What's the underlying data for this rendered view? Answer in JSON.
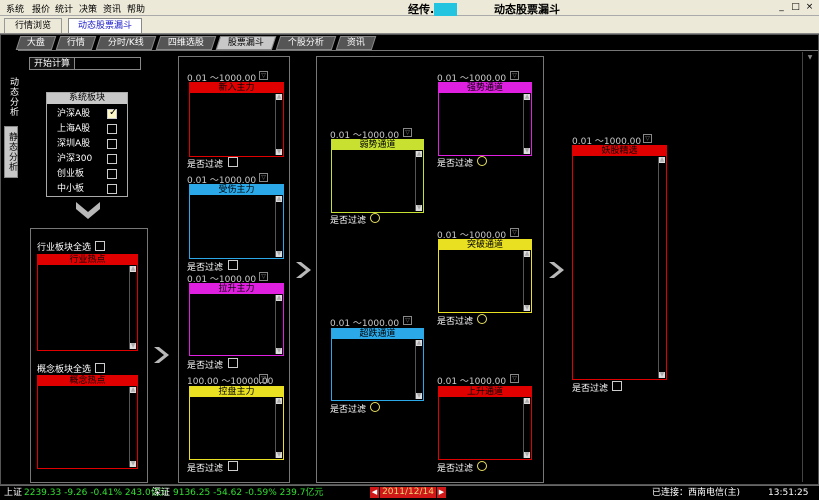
{
  "menubar": {
    "items": [
      "系统",
      "报价",
      "统计",
      "决策",
      "资讯",
      "帮助"
    ],
    "title_masked": "经传.",
    "title_mask_text": "····",
    "subtitle": "动态股票漏斗",
    "win_buttons": [
      "_",
      "□",
      "×"
    ]
  },
  "top_tabs": [
    {
      "label": "行情浏览"
    },
    {
      "label": "动态股票漏斗"
    }
  ],
  "nav_tabs": [
    "大盘",
    "行情",
    "分时/K线",
    "四维选股",
    "股票漏斗",
    "个股分析",
    "资讯"
  ],
  "side_tabs": [
    "动态分析",
    "静态分析"
  ],
  "start_button": "开始计算",
  "system_sector": {
    "title": "系统板块",
    "items": [
      {
        "label": "沪深A股",
        "checked": true
      },
      {
        "label": "上海A股",
        "checked": false
      },
      {
        "label": "深圳A股",
        "checked": false
      },
      {
        "label": "沪深300",
        "checked": false
      },
      {
        "label": "创业板",
        "checked": false
      },
      {
        "label": "中小板",
        "checked": false
      }
    ]
  },
  "sector_group": {
    "industry_select_all": "行业板块全选",
    "industry_panel": "行业热点",
    "concept_select_all": "概念板块全选",
    "concept_panel": "概念热点"
  },
  "filter_label": "是否过滤",
  "col1": [
    {
      "range": "0.01 ～1000.00",
      "title": "新入主力",
      "color": "#e00000"
    },
    {
      "range": "0.01 ～1000.00",
      "title": "受伤主力",
      "color": "#2aa8e8"
    },
    {
      "range": "0.01 ～1000.00",
      "title": "拉升主力",
      "color": "#e020e0"
    },
    {
      "range": "100.00 ～10000.00",
      "title": "控盘主力",
      "color": "#e8e020"
    }
  ],
  "col2": [
    {
      "range": "0.01 ～1000.00",
      "title": "弱势通道",
      "color": "#c8e030"
    },
    {
      "range": "0.01 ～1000.00",
      "title": "超跌通道",
      "color": "#2aa8e8"
    }
  ],
  "col3": [
    {
      "range": "0.01 ～1000.00",
      "title": "强势通道",
      "color": "#e020e0"
    },
    {
      "range": "0.01 ～1000.00",
      "title": "突破通道",
      "color": "#e8e020"
    },
    {
      "range": "0.01 ～1000.00",
      "title": "上升通道",
      "color": "#e00000"
    }
  ],
  "col4": {
    "range": "0.01 ～1000.00",
    "title": "妖股精选",
    "color": "#e00000"
  },
  "status": {
    "sh_label": "上证",
    "sh_values": "2239.33 -9.26 -0.41% 243.0亿元",
    "sz_label": "深证",
    "sz_values": "9136.25 -54.62 -0.59% 239.7亿元",
    "date": "2011/12/14",
    "connection_label": "已连接：",
    "server": "西南电信(主)",
    "time": "13:51:25"
  }
}
